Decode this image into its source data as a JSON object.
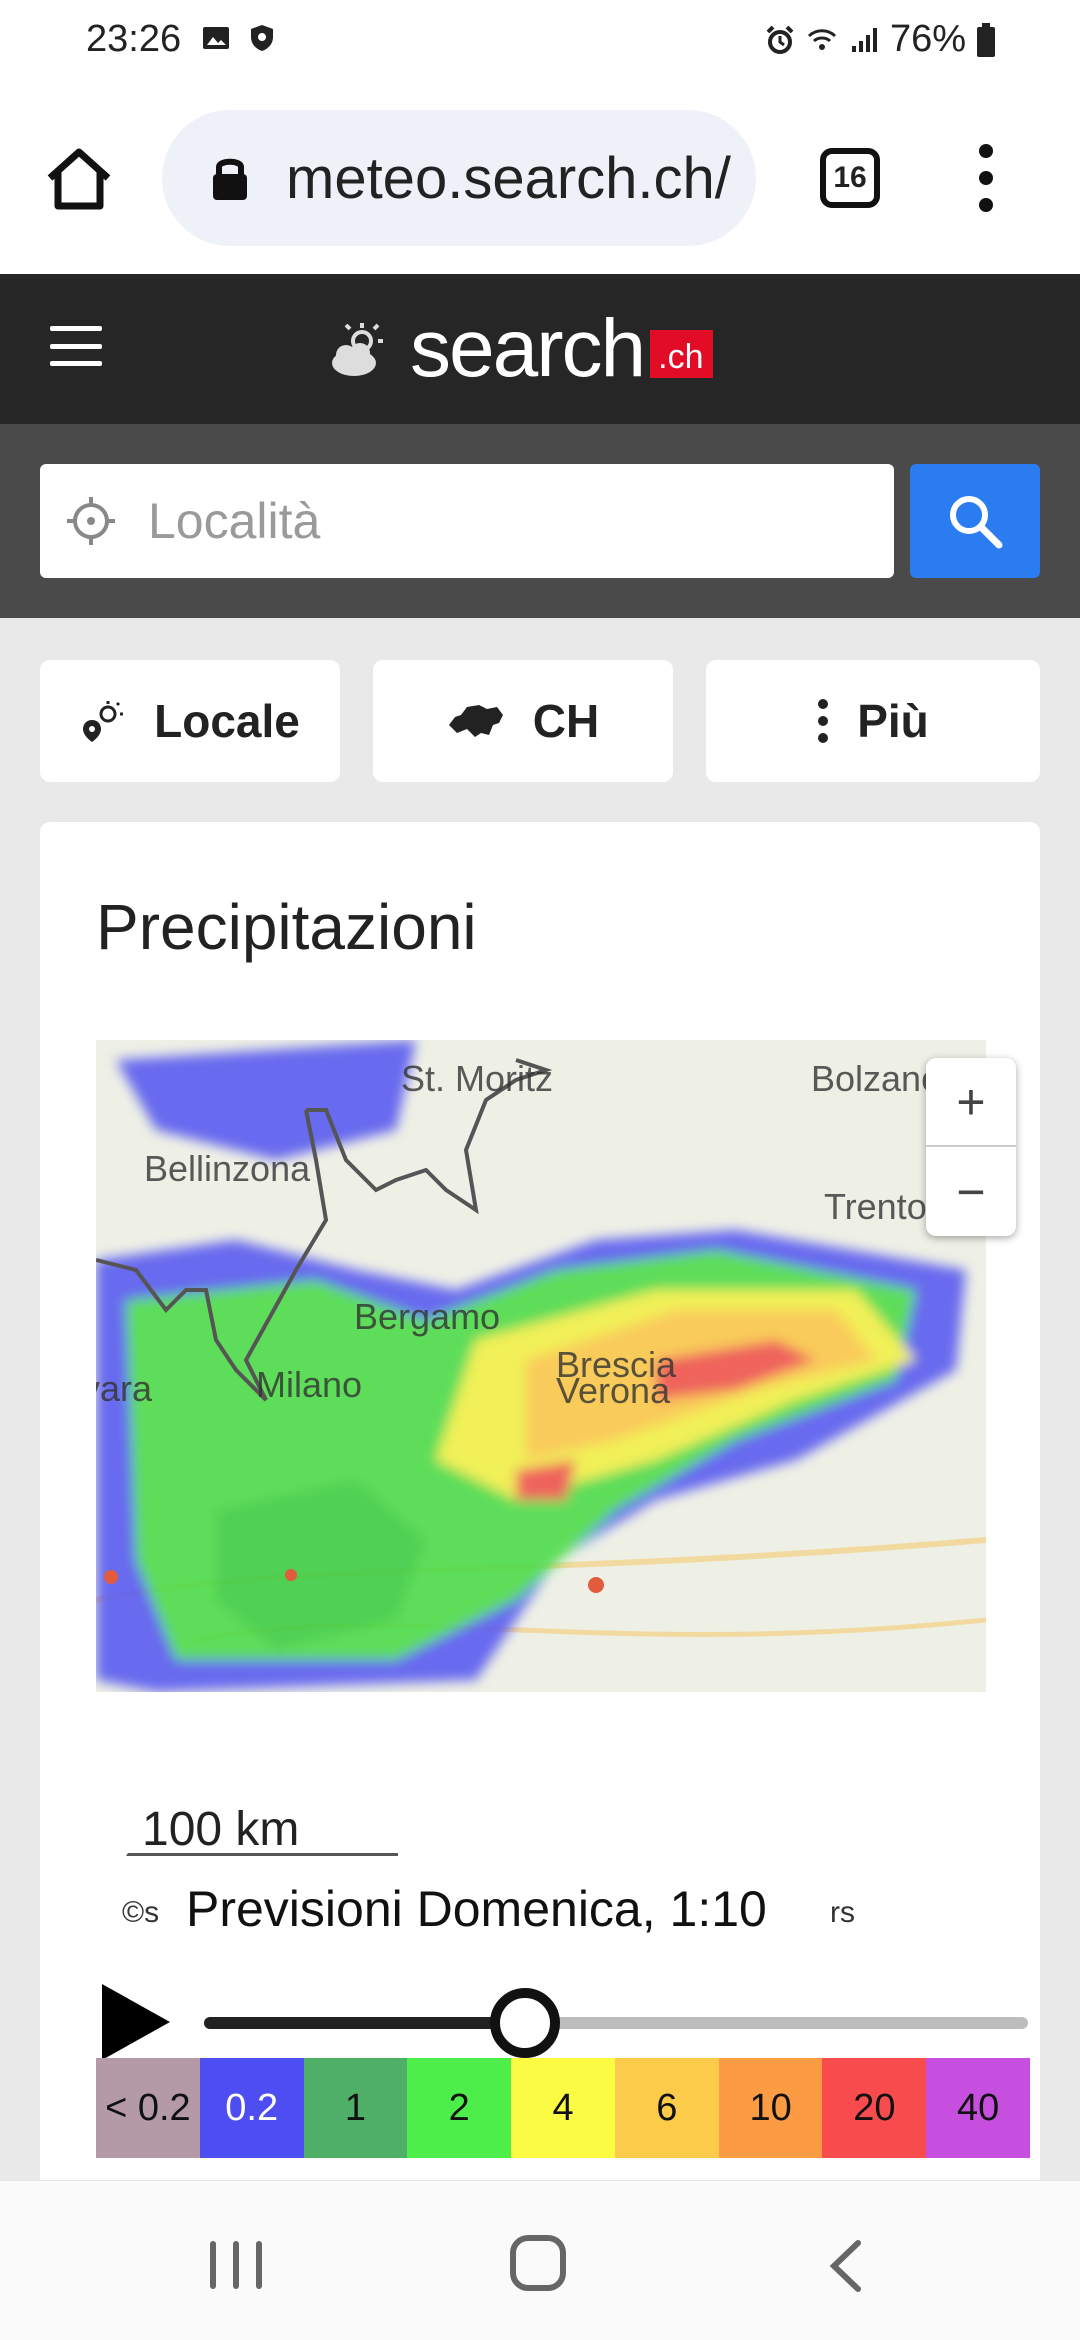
{
  "status_bar": {
    "time": "23:26",
    "battery": "76%",
    "icons": [
      "gallery-icon",
      "shield-icon",
      "alarm-icon",
      "wifi-icon",
      "signal-icon",
      "battery-icon"
    ]
  },
  "browser": {
    "url": "meteo.search.ch/",
    "tab_count": "16"
  },
  "site": {
    "logo_text": "search",
    "logo_suffix": ".ch",
    "search_placeholder": "Località"
  },
  "nav_chips": [
    {
      "label": "Locale",
      "icon": "weather-location-icon"
    },
    {
      "label": "CH",
      "icon": "switzerland-icon"
    },
    {
      "label": "Più",
      "icon": "more-vertical-icon"
    }
  ],
  "card": {
    "title": "Precipitazioni"
  },
  "map": {
    "labels": {
      "st_moritz": "St. Moritz",
      "bolzano": "Bolzano",
      "bellinzona": "Bellinzona",
      "trento": "Trento",
      "bergamo": "Bergamo",
      "brescia": "Brescia",
      "novara": "Novara",
      "milano": "Milano",
      "verona": "Verona"
    },
    "zoom_in": "+",
    "zoom_out": "−",
    "scale": "100 km",
    "attribution_left": "©s",
    "attribution_right": "rs"
  },
  "forecast": {
    "label": "Previsioni Domenica, 1:10",
    "progress_percent": 39
  },
  "legend": [
    {
      "label": "< 0.2",
      "color": "#b39aa6"
    },
    {
      "label": "0.2",
      "color": "#4e4df2"
    },
    {
      "label": "1",
      "color": "#4fae67"
    },
    {
      "label": "2",
      "color": "#4dee4a"
    },
    {
      "label": "4",
      "color": "#fbfb44"
    },
    {
      "label": "6",
      "color": "#fccb49"
    },
    {
      "label": "10",
      "color": "#fb9b44"
    },
    {
      "label": "20",
      "color": "#f74b4e"
    },
    {
      "label": "40",
      "color": "#c64fe0"
    }
  ],
  "colors": {
    "header_bg": "#262626",
    "search_button": "#2b7cf0",
    "brand_red": "#e30c26"
  }
}
